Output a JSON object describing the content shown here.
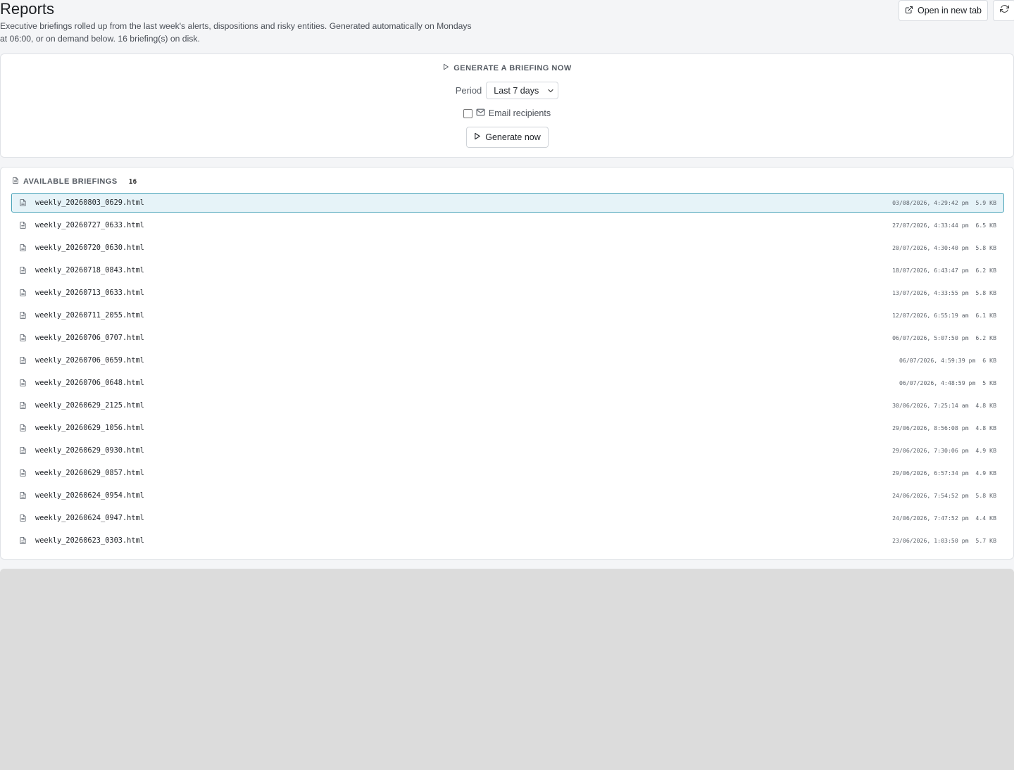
{
  "header": {
    "title": "Reports",
    "subtitle": "Executive briefings rolled up from the last week's alerts, dispositions and risky entities. Generated automatically on Mondays at 06:00, or on demand below. 16 briefing(s) on disk.",
    "open_new_tab_label": "Open in new tab",
    "refresh_icon": "refresh-icon"
  },
  "generate": {
    "heading": "GENERATE A BRIEFING NOW",
    "period_label": "Period",
    "period_value": "Last 7 days",
    "email_label": "Email recipients",
    "email_checked": false,
    "button_label": "Generate now"
  },
  "briefings": {
    "heading": "AVAILABLE BRIEFINGS",
    "count": "16",
    "selected_index": 0,
    "items": [
      {
        "name": "weekly_20260803_0629.html",
        "date": "03/08/2026, 4:29:42 pm",
        "size": "5.9 KB"
      },
      {
        "name": "weekly_20260727_0633.html",
        "date": "27/07/2026, 4:33:44 pm",
        "size": "6.5 KB"
      },
      {
        "name": "weekly_20260720_0630.html",
        "date": "20/07/2026, 4:30:40 pm",
        "size": "5.8 KB"
      },
      {
        "name": "weekly_20260718_0843.html",
        "date": "18/07/2026, 6:43:47 pm",
        "size": "6.2 KB"
      },
      {
        "name": "weekly_20260713_0633.html",
        "date": "13/07/2026, 4:33:55 pm",
        "size": "5.8 KB"
      },
      {
        "name": "weekly_20260711_2055.html",
        "date": "12/07/2026, 6:55:19 am",
        "size": "6.1 KB"
      },
      {
        "name": "weekly_20260706_0707.html",
        "date": "06/07/2026, 5:07:50 pm",
        "size": "6.2 KB"
      },
      {
        "name": "weekly_20260706_0659.html",
        "date": "06/07/2026, 4:59:39 pm",
        "size": "6 KB"
      },
      {
        "name": "weekly_20260706_0648.html",
        "date": "06/07/2026, 4:48:59 pm",
        "size": "5 KB"
      },
      {
        "name": "weekly_20260629_2125.html",
        "date": "30/06/2026, 7:25:14 am",
        "size": "4.8 KB"
      },
      {
        "name": "weekly_20260629_1056.html",
        "date": "29/06/2026, 8:56:08 pm",
        "size": "4.8 KB"
      },
      {
        "name": "weekly_20260629_0930.html",
        "date": "29/06/2026, 7:30:06 pm",
        "size": "4.9 KB"
      },
      {
        "name": "weekly_20260629_0857.html",
        "date": "29/06/2026, 6:57:34 pm",
        "size": "4.9 KB"
      },
      {
        "name": "weekly_20260624_0954.html",
        "date": "24/06/2026, 7:54:52 pm",
        "size": "5.8 KB"
      },
      {
        "name": "weekly_20260624_0947.html",
        "date": "24/06/2026, 7:47:52 pm",
        "size": "4.4 KB"
      },
      {
        "name": "weekly_20260623_0303.html",
        "date": "23/06/2026, 1:03:50 pm",
        "size": "5.7 KB"
      }
    ]
  },
  "colors": {
    "selected_bg": "#e6f3f8",
    "selected_border": "#4aa3b8",
    "preview_bg": "#dcdcdc"
  }
}
